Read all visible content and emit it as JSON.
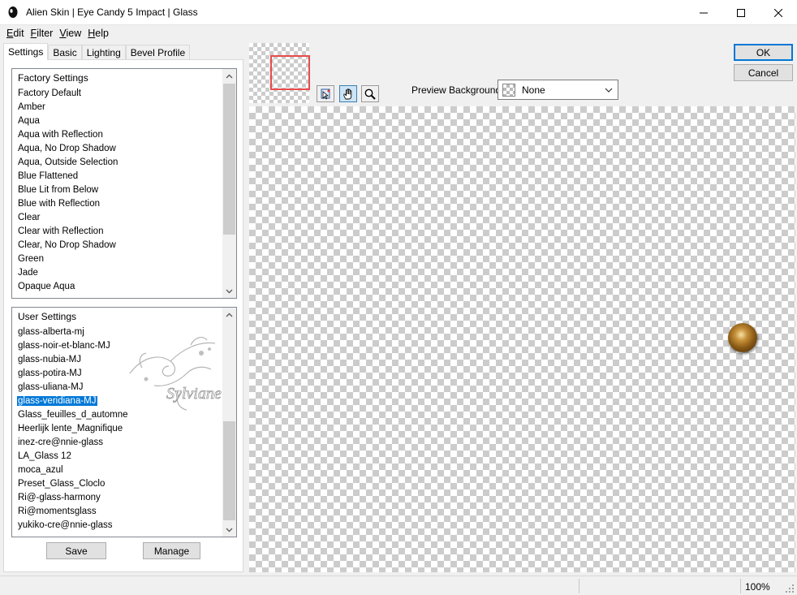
{
  "window": {
    "title": "Alien Skin | Eye Candy 5 Impact | Glass"
  },
  "menu": [
    {
      "label": "Edit",
      "hotkey": "E",
      "rest": "dit"
    },
    {
      "label": "Filter",
      "hotkey": "F",
      "rest": "ilter"
    },
    {
      "label": "View",
      "hotkey": "V",
      "rest": "iew"
    },
    {
      "label": "Help",
      "hotkey": "H",
      "rest": "elp"
    }
  ],
  "tabs": [
    "Settings",
    "Basic",
    "Lighting",
    "Bevel Profile"
  ],
  "factory": {
    "header": "Factory Settings",
    "items": [
      "Factory Default",
      "Amber",
      "Aqua",
      "Aqua with Reflection",
      "Aqua, No Drop Shadow",
      "Aqua, Outside Selection",
      "Blue Flattened",
      "Blue Lit from Below",
      "Blue with Reflection",
      "Clear",
      "Clear with Reflection",
      "Clear, No Drop Shadow",
      "Green",
      "Jade",
      "Opaque Aqua"
    ]
  },
  "user": {
    "header": "User Settings",
    "items": [
      "glass-alberta-mj",
      "glass-noir-et-blanc-MJ",
      "glass-nubia-MJ",
      "glass-potira-MJ",
      "glass-uliana-MJ",
      "glass-veridiana-MJ",
      "Glass_feuilles_d_automne",
      "Heerlijk lente_Magnifique",
      "inez-cre@nnie-glass",
      "LA_Glass 12",
      "moca_azul",
      "Preset_Glass_Cloclo",
      "Ri@-glass-harmony",
      "Ri@momentsglass",
      "yukiko-cre@nnie-glass"
    ],
    "selected_index": 5
  },
  "buttons": {
    "save": "Save",
    "manage": "Manage",
    "ok": "OK",
    "cancel": "Cancel"
  },
  "preview": {
    "background_label": "Preview Background:",
    "background_value": "None"
  },
  "status": {
    "zoom": "100%"
  },
  "watermark": {
    "text": "Sylviane"
  },
  "colors": {
    "selection": "#0078d7",
    "navigator_frame": "#e74c4c",
    "glass_ball": "#8a5a16"
  }
}
